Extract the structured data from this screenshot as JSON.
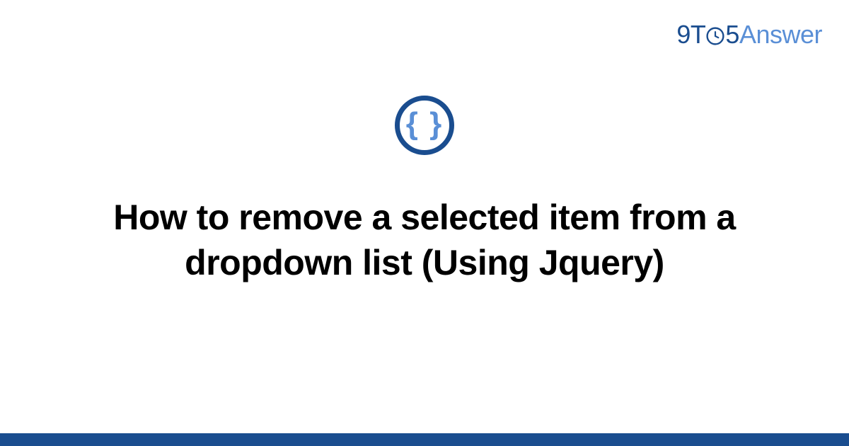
{
  "logo": {
    "part1": "9T",
    "part2": "5",
    "part3": "Answer"
  },
  "icon": {
    "glyph": "{ }"
  },
  "title": "How to remove a selected item from a dropdown list (Using Jquery)"
}
